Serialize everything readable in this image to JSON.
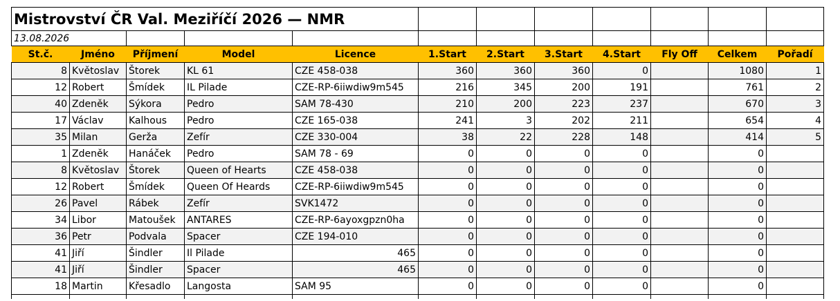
{
  "title": "Mistrovství ČR Val. Meziříčí 2026 — NMR",
  "date": "13.08.2026",
  "columns": [
    "St.č.",
    "Jméno",
    "Příjmení",
    "Model",
    "Licence",
    "1.Start",
    "2.Start",
    "3.Start",
    "4.Start",
    "Fly Off",
    "Celkem",
    "Pořadí"
  ],
  "rows": [
    [
      "8",
      "Květoslav",
      "Štorek",
      "KL 61",
      "CZE 458-038",
      "360",
      "360",
      "360",
      "0",
      "",
      "1080",
      "1"
    ],
    [
      "12",
      "Robert",
      "Šmídek",
      "IL Pilade",
      "CZE-RP-6iiwdiw9m545",
      "216",
      "345",
      "200",
      "191",
      "",
      "761",
      "2"
    ],
    [
      "40",
      "Zdeněk",
      "Sýkora",
      "Pedro",
      "SAM 78-430",
      "210",
      "200",
      "223",
      "237",
      "",
      "670",
      "3"
    ],
    [
      "17",
      "Václav",
      "Kalhous",
      "Pedro",
      "CZE 165-038",
      "241",
      "3",
      "202",
      "211",
      "",
      "654",
      "4"
    ],
    [
      "35",
      "Milan",
      "Gerža",
      "Zefír",
      "CZE 330-004",
      "38",
      "22",
      "228",
      "148",
      "",
      "414",
      "5"
    ],
    [
      "1",
      "Zdeněk",
      "Hanáček",
      "Pedro",
      "SAM 78 - 69",
      "0",
      "0",
      "0",
      "0",
      "",
      "0",
      ""
    ],
    [
      "8",
      "Květoslav",
      "Štorek",
      "Queen of Hearts",
      "CZE 458-038",
      "0",
      "0",
      "0",
      "0",
      "",
      "0",
      ""
    ],
    [
      "12",
      "Robert",
      "Šmídek",
      "Queen Of Heards",
      "CZE-RP-6iiwdiw9m545",
      "0",
      "0",
      "0",
      "0",
      "",
      "0",
      ""
    ],
    [
      "26",
      "Pavel",
      "Rábek",
      "Zefír",
      "SVK1472",
      "0",
      "0",
      "0",
      "0",
      "",
      "0",
      ""
    ],
    [
      "34",
      "Libor",
      "Matoušek",
      "ANTARES",
      "CZE-RP-6ayoxgpzn0ha",
      "0",
      "0",
      "0",
      "0",
      "",
      "0",
      ""
    ],
    [
      "36",
      "Petr",
      "Podvala",
      "Spacer",
      "CZE 194-010",
      "0",
      "0",
      "0",
      "0",
      "",
      "0",
      ""
    ],
    [
      "41",
      "Jiří",
      "Šindler",
      "Il Pilade",
      "465",
      "0",
      "0",
      "0",
      "0",
      "",
      "0",
      ""
    ],
    [
      "41",
      "Jiří",
      "Šindler",
      "Spacer",
      "465",
      "0",
      "0",
      "0",
      "0",
      "",
      "0",
      ""
    ],
    [
      "18",
      "Martin",
      "Křesadlo",
      "Langosta",
      "SAM 95",
      "0",
      "0",
      "0",
      "0",
      "",
      "0",
      ""
    ]
  ],
  "colors": {
    "header_bg": "#ffc000",
    "stripe_bg": "#f2f2f2",
    "grid": "#000000"
  }
}
